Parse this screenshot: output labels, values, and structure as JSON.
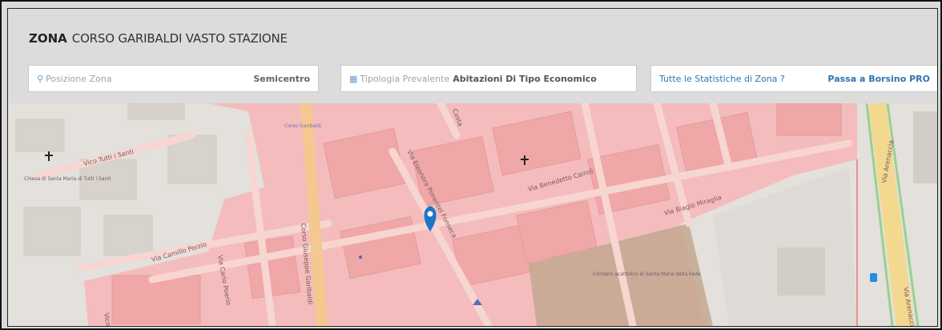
{
  "zone": {
    "label": "ZONA",
    "name": "CORSO GARIBALDI VASTO STAZIONE"
  },
  "position": {
    "label": "Posizione Zona",
    "value": "Semicentro",
    "icon": "location-pin-icon"
  },
  "typology": {
    "label": "Tipologia Prevalente",
    "value": "Abitazioni Di Tipo Economico",
    "icon": "building-icon"
  },
  "stats": {
    "question": "Tutte le Statistiche di Zona ?",
    "link": "Passa a Borsino PRO"
  },
  "map": {
    "streets": {
      "vico_tutti_santi": "Vico Tutti i Santi",
      "via_camillo_porzio": "Via Camillo Porzio",
      "via_carlo_poerio": "Via Carlo Poerio",
      "corso_garibaldi": "Corso Giuseppe Garibaldi",
      "via_benedetto_cairoli": "Via Benedetto Cairoli",
      "via_biagio_miraglia": "Via Biagio Miraglia",
      "via_arenaccia_top": "Via Arenaccia",
      "via_arenaccia_bottom": "Via Arenaccia",
      "via_fonseca": "Via Eleonora Pimentel Fonseca",
      "vico": "Vico 3",
      "costa": "Costa"
    },
    "pois": {
      "church": "Chiesa di Santa Maria di Tutti i Santi",
      "cemetery": "Cimitero acattolico di Santa Maria della Fede",
      "corso_garibaldi_poi": "Corso Garibaldi",
      "bus": "fermata"
    },
    "colors": {
      "zone_fill": "#f4b9b9",
      "road": "#f7d0cc",
      "main_road": "#f3c98f",
      "park": "#c3a890"
    }
  }
}
